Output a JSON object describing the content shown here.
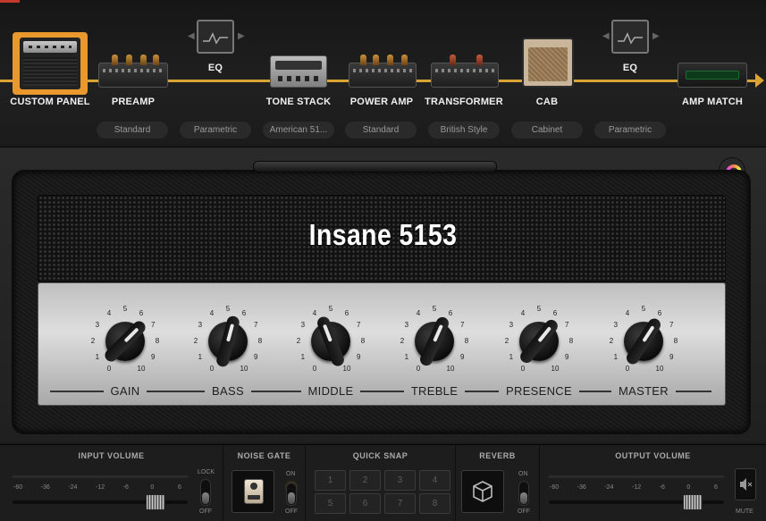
{
  "chain": {
    "modules": [
      {
        "label": "CUSTOM PANEL",
        "icon": "amp-head-icon"
      },
      {
        "label": "PREAMP",
        "icon": "preamp-icon"
      },
      {
        "label": "EQ",
        "icon": "eq-graph-icon"
      },
      {
        "label": "TONE STACK",
        "icon": "tone-stack-icon"
      },
      {
        "label": "POWER AMP",
        "icon": "power-amp-icon"
      },
      {
        "label": "TRANSFORMER",
        "icon": "transformer-icon"
      },
      {
        "label": "CAB",
        "icon": "cabinet-icon"
      },
      {
        "label": "EQ",
        "icon": "eq-graph-icon"
      },
      {
        "label": "AMP MATCH",
        "icon": "amp-match-icon"
      }
    ],
    "subs": [
      "Standard",
      "Parametric",
      "American 51...",
      "Standard",
      "British Style",
      "Cabinet",
      "Parametric"
    ],
    "accent": "#d9a431",
    "selected_color": "#e8982d"
  },
  "amp": {
    "title": "Insane 5153",
    "knobs": [
      {
        "name": "GAIN",
        "value": 6.5
      },
      {
        "name": "BASS",
        "value": 5.5
      },
      {
        "name": "MIDDLE",
        "value": 4.3
      },
      {
        "name": "TREBLE",
        "value": 5.8
      },
      {
        "name": "PRESENCE",
        "value": 6.3
      },
      {
        "name": "MASTER",
        "value": 6.1
      }
    ],
    "ticks": [
      "0",
      "1",
      "2",
      "3",
      "4",
      "5",
      "6",
      "7",
      "8",
      "9",
      "10"
    ]
  },
  "bottom": {
    "input_volume": {
      "title": "INPUT VOLUME",
      "scale": [
        "-60",
        "-36",
        "-24",
        "-12",
        "-6",
        "0",
        "6"
      ],
      "lock_label": "LOCK",
      "off_label": "OFF"
    },
    "noise_gate": {
      "title": "NOISE GATE",
      "on_label": "ON",
      "off_label": "OFF"
    },
    "quick_snap": {
      "title": "QUICK SNAP",
      "slots": [
        "1",
        "2",
        "3",
        "4",
        "5",
        "6",
        "7",
        "8"
      ]
    },
    "reverb": {
      "title": "REVERB",
      "on_label": "ON",
      "off_label": "OFF"
    },
    "output_volume": {
      "title": "OUTPUT VOLUME",
      "scale": [
        "-60",
        "-36",
        "-24",
        "-12",
        "-6",
        "0",
        "6"
      ],
      "mute_label": "MUTE"
    }
  }
}
